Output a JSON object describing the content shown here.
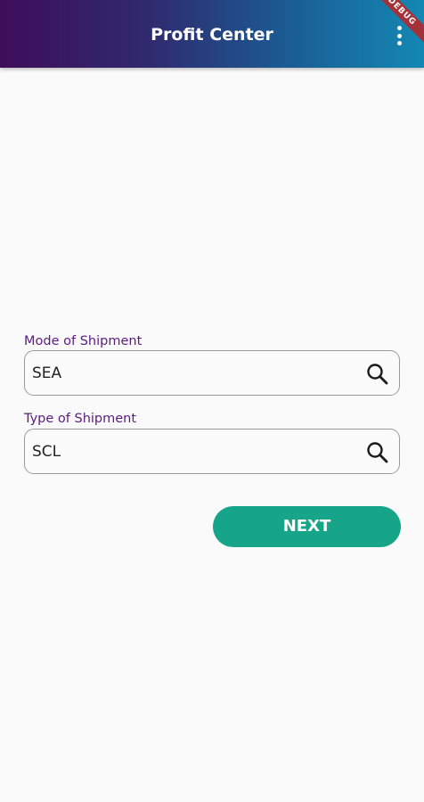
{
  "app_bar": {
    "title": "Profit Center",
    "menu_icon": "more-vert-icon",
    "debug_banner": "DEBUG"
  },
  "form": {
    "mode_of_shipment": {
      "label": "Mode of Shipment",
      "value": "SEA",
      "icon": "search-icon"
    },
    "type_of_shipment": {
      "label": "Type of Shipment",
      "value": "SCL",
      "icon": "search-icon"
    },
    "next_button": {
      "label": "NEXT"
    }
  },
  "colors": {
    "app_bar_gradient_start": "#3f0d5a",
    "app_bar_gradient_end": "#1388b3",
    "label": "#5d1a82",
    "button": "#16a589",
    "background": "#fafafa"
  }
}
